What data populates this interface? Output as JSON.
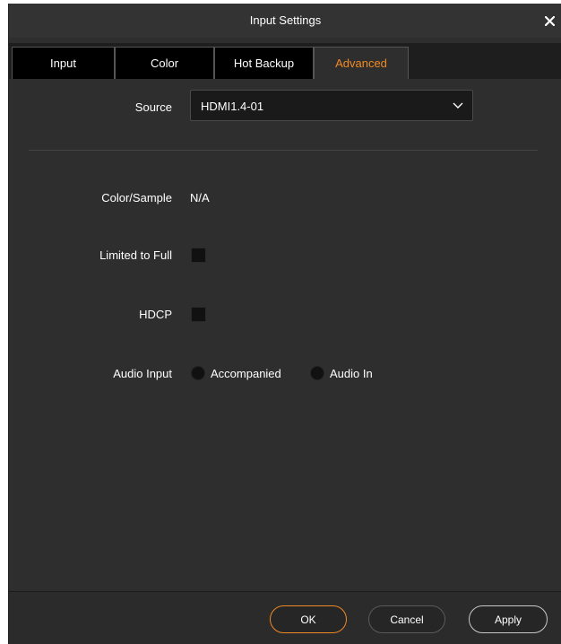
{
  "window": {
    "title": "Input Settings",
    "close_icon": "close-icon"
  },
  "tabs": [
    {
      "label": "Input",
      "active": false
    },
    {
      "label": "Color",
      "active": false
    },
    {
      "label": "Hot Backup",
      "active": false
    },
    {
      "label": "Advanced",
      "active": true
    }
  ],
  "form": {
    "source": {
      "label": "Source",
      "value": "HDMI1.4-01",
      "icon": "chevron-down-icon"
    },
    "color_sample": {
      "label": "Color/Sample",
      "value": "N/A"
    },
    "limited_to_full": {
      "label": "Limited to Full",
      "checked": false
    },
    "hdcp": {
      "label": "HDCP",
      "checked": false
    },
    "audio_input": {
      "label": "Audio Input",
      "options": [
        {
          "label": "Accompanied",
          "selected": false
        },
        {
          "label": "Audio In",
          "selected": false
        }
      ]
    }
  },
  "buttons": {
    "ok": "OK",
    "cancel": "Cancel",
    "apply": "Apply"
  },
  "colors": {
    "accent": "#f08a24",
    "background": "#2e2e2e",
    "tab_inactive": "#000000"
  }
}
